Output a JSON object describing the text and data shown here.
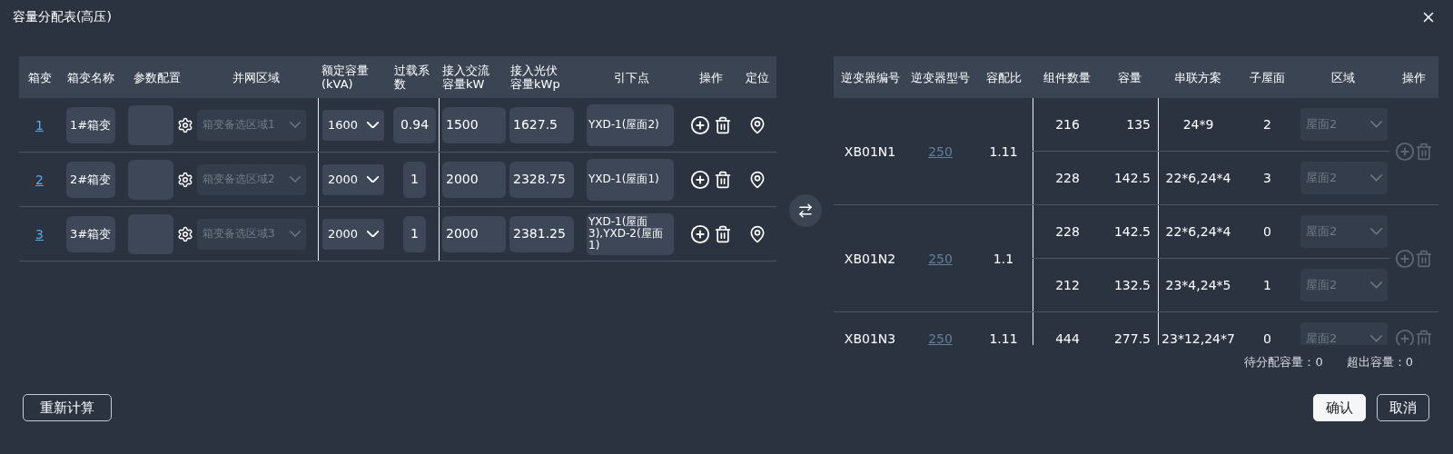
{
  "window": {
    "title": "容量分配表(高压)"
  },
  "left_table": {
    "columns": [
      "箱变",
      "箱变名称",
      "参数配置",
      "并网区域",
      "额定容量(kVA)",
      "过载系数",
      "接入交流容量kW",
      "接入光伏容量kWp",
      "引下点",
      "操作",
      "定位"
    ],
    "rows": [
      {
        "index": "1",
        "name": "1#箱变",
        "region": {
          "value": "箱变备选区域1",
          "disabled": true
        },
        "capacity": "1600",
        "overload": "0.94",
        "ac": "1500",
        "pv": "1627.5",
        "drop_point": "YXD-1(屋面2)"
      },
      {
        "index": "2",
        "name": "2#箱变",
        "region": {
          "value": "箱变备选区域2",
          "disabled": true
        },
        "capacity": "2000",
        "overload": "1",
        "ac": "2000",
        "pv": "2328.75",
        "drop_point": "YXD-1(屋面1)"
      },
      {
        "index": "3",
        "name": "3#箱变",
        "region": {
          "value": "箱变备选区域3",
          "disabled": true
        },
        "capacity": "2000",
        "overload": "1",
        "ac": "2000",
        "pv": "2381.25",
        "drop_point": "YXD-1(屋面3),YXD-2(屋面1)"
      }
    ]
  },
  "right_table": {
    "columns": [
      "逆变器编号",
      "逆变器型号",
      "容配比",
      "组件数量",
      "容量",
      "串联方案",
      "子屋面",
      "区域",
      "操作"
    ],
    "groups": [
      {
        "id": "XB01N1",
        "model": "250",
        "ratio": "1.11",
        "actions_disabled": true,
        "items": [
          {
            "count": "216",
            "capacity": "135",
            "scheme": "24*9",
            "sub_roof": "2",
            "region": {
              "value": "屋面2",
              "disabled": true
            }
          },
          {
            "count": "228",
            "capacity": "142.5",
            "scheme": "22*6,24*4",
            "sub_roof": "3",
            "region": {
              "value": "屋面2",
              "disabled": true
            }
          }
        ]
      },
      {
        "id": "XB01N2",
        "model": "250",
        "ratio": "1.1",
        "actions_disabled": true,
        "items": [
          {
            "count": "228",
            "capacity": "142.5",
            "scheme": "22*6,24*4",
            "sub_roof": "0",
            "region": {
              "value": "屋面2",
              "disabled": true
            }
          },
          {
            "count": "212",
            "capacity": "132.5",
            "scheme": "23*4,24*5",
            "sub_roof": "1",
            "region": {
              "value": "屋面2",
              "disabled": true
            }
          }
        ]
      },
      {
        "id": "XB01N3",
        "model": "250",
        "ratio": "1.11",
        "actions_disabled": true,
        "items": [
          {
            "count": "444",
            "capacity": "277.5",
            "scheme": "23*12,24*7",
            "sub_roof": "0",
            "region": {
              "value": "屋面2",
              "disabled": true
            }
          }
        ]
      }
    ]
  },
  "summary": [
    {
      "label": "待分配容量：",
      "value": "0"
    },
    {
      "label": "超出容量：",
      "value": "0"
    }
  ],
  "recalc_button": "重新计算",
  "buttons": [
    {
      "label": "确认",
      "kind": "primary"
    },
    {
      "label": "取消",
      "kind": "outline"
    }
  ]
}
